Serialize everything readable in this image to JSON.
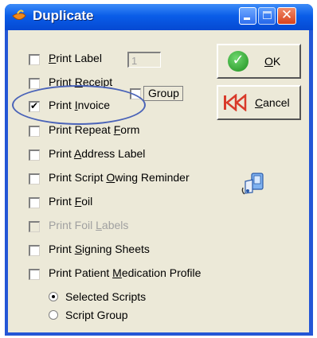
{
  "window": {
    "title": "Duplicate",
    "controls": [
      "minimize",
      "maximize",
      "close"
    ],
    "close_glyph": "✕",
    "title_icon": "app-flame-icon"
  },
  "options": [
    {
      "id": "print-label",
      "pre": "",
      "key": "P",
      "post": "rint Label",
      "checked": false,
      "disabled": false
    },
    {
      "id": "print-receipt",
      "pre": "Print ",
      "key": "R",
      "post": "eceipt",
      "checked": false,
      "disabled": false
    },
    {
      "id": "print-invoice",
      "pre": "Print ",
      "key": "I",
      "post": "nvoice",
      "checked": true,
      "disabled": false
    },
    {
      "id": "print-repeat-form",
      "pre": "Print Repeat ",
      "key": "F",
      "post": "orm",
      "checked": false,
      "disabled": false
    },
    {
      "id": "print-address-label",
      "pre": "Print ",
      "key": "A",
      "post": "ddress Label",
      "checked": false,
      "disabled": false
    },
    {
      "id": "print-script-owing-reminder",
      "pre": "Print Script ",
      "key": "O",
      "post": "wing Reminder",
      "checked": false,
      "disabled": false
    },
    {
      "id": "print-foil",
      "pre": "Print ",
      "key": "F",
      "post": "oil",
      "checked": false,
      "disabled": false
    },
    {
      "id": "print-foil-labels",
      "pre": "Print Foil ",
      "key": "L",
      "post": "abels",
      "checked": false,
      "disabled": true
    },
    {
      "id": "print-signing-sheets",
      "pre": "Print ",
      "key": "S",
      "post": "igning Sheets",
      "checked": false,
      "disabled": false
    },
    {
      "id": "print-patient-medication-profile",
      "pre": "Print Patient ",
      "key": "M",
      "post": "edication Profile",
      "checked": false,
      "disabled": false
    }
  ],
  "label_count": {
    "value": "1"
  },
  "group": {
    "label": "Group",
    "checked": false
  },
  "buttons": {
    "ok": {
      "key": "O",
      "rest": "K"
    },
    "cancel": {
      "key": "C",
      "rest": "ancel"
    }
  },
  "scope": {
    "selected_scripts": {
      "label": "Selected Scripts",
      "selected": true
    },
    "script_group": {
      "label": "Script Group",
      "selected": false
    }
  },
  "icons": {
    "scanner": "scanner-icon",
    "ok": "checkmark-icon",
    "cancel": "rewind-icon"
  },
  "colors": {
    "titlebar": "#0a5de8",
    "client": "#ece9d8",
    "highlight_oval": "#4a63b8",
    "ok_icon": "#2aa52a",
    "cancel_icon": "#d93a2a"
  }
}
